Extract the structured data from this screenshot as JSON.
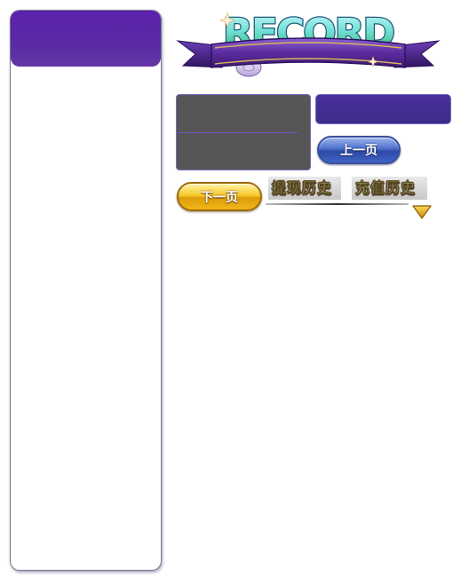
{
  "banner": {
    "title": "RECORD"
  },
  "pagination": {
    "prev_label": "上一页",
    "next_label": "下一页"
  },
  "tabs": [
    {
      "label": "提现历史"
    },
    {
      "label": "充值历史"
    }
  ],
  "colors": {
    "panel_header": "#5b22ad",
    "purple_bar": "#4a2f9c",
    "grey_box": "#565656",
    "prev_button": "#4d6fcc",
    "next_button": "#f7c92a",
    "arrow": "#e2a90a"
  },
  "icons": {
    "sparkle": "sparkle-icon",
    "scroll": "scroll-icon",
    "dropdown": "triangle-down-icon"
  }
}
